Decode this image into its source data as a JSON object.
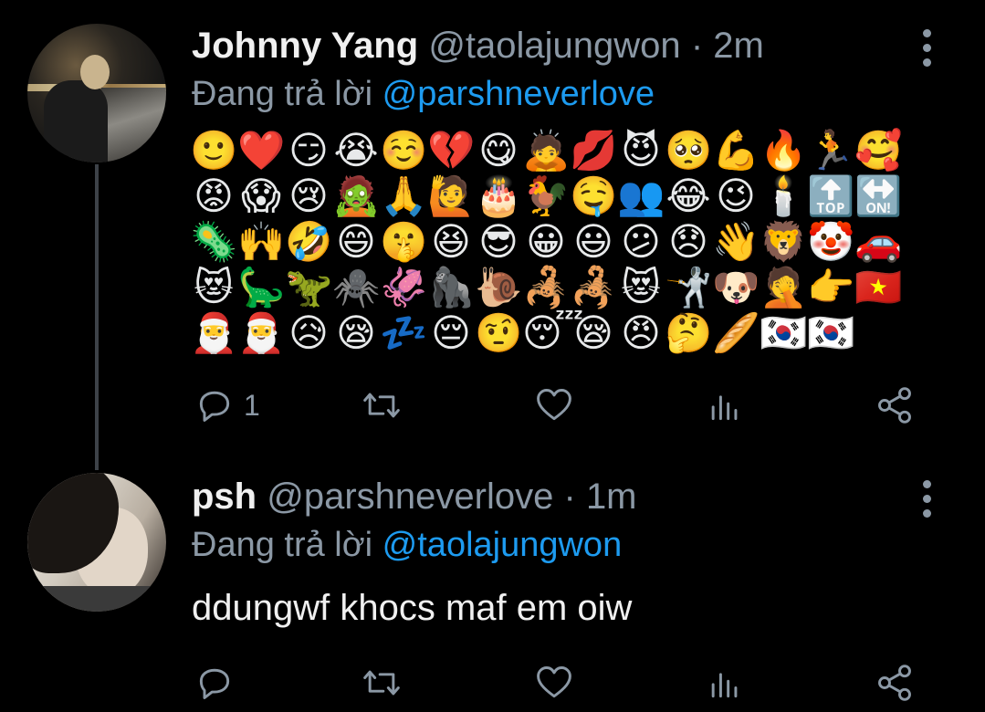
{
  "tweets": [
    {
      "name": "Johnny Yang",
      "handle": "@taolajungwon",
      "separator": "·",
      "time": "2m",
      "reply_prefix": "Đang trả lời ",
      "reply_to": "@parshneverlove",
      "emoji_rows": [
        "🙂❤️😏😭☺️💔😋🙇💋😈🥺💪🔥🏃🥰",
        "😡😱😢🧟🙏🙋🎂🐓🤤👥😂😉🕯️🔝🔛",
        "🦠🙌🤣😄🤫😆😎😀😃😕😞👋🦁🤡🚗",
        "😻🦕🦖🕷️🦑🦍🐌🦂🦂😻🤺🐶🤦👉🇻🇳",
        "🎅🎅😥😪💤😔🤨😴😪😠🤔🥖🇰🇷🇰🇷"
      ],
      "text": "",
      "actions": {
        "reply_icon": "reply-icon",
        "reply_count": "1",
        "retweet_icon": "retweet-icon",
        "retweet_count": "",
        "like_icon": "heart-icon",
        "like_count": "",
        "views_icon": "views-icon",
        "share_icon": "share-icon"
      }
    },
    {
      "name": "psh",
      "handle": "@parshneverlove",
      "separator": "·",
      "time": "1m",
      "reply_prefix": "Đang trả lời ",
      "reply_to": "@taolajungwon",
      "text": "ddungwf khocs maf em oiw",
      "actions": {
        "reply_icon": "reply-icon",
        "reply_count": "",
        "retweet_icon": "retweet-icon",
        "retweet_count": "",
        "like_icon": "heart-icon",
        "like_count": "",
        "views_icon": "views-icon",
        "share_icon": "share-icon"
      }
    }
  ],
  "colors": {
    "background": "#000000",
    "text": "#e7e9ea",
    "secondary": "#8b98a5",
    "mention": "#1d9bf0",
    "thread_line": "#3d4248"
  }
}
